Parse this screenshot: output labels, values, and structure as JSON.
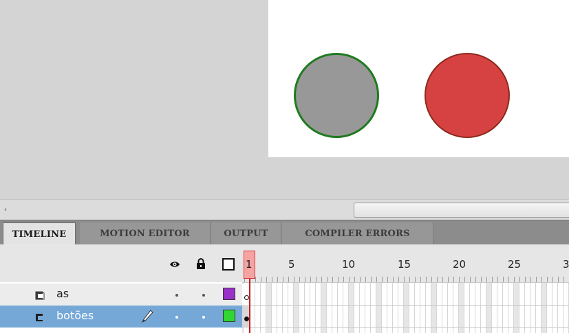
{
  "stage": {
    "pasteboard_color": "#d4d4d4",
    "stage_color": "#ffffff",
    "circles": [
      {
        "name": "gray-circle",
        "fill": "#989898",
        "stroke": "#1f7a1f"
      },
      {
        "name": "red-circle",
        "fill": "#d64141",
        "stroke": "#8b2a1d"
      }
    ]
  },
  "scrollbar": {
    "left_arrow": "‹"
  },
  "tabs": [
    {
      "label": "TIMELINE",
      "active": true
    },
    {
      "label": "MOTION EDITOR",
      "active": false
    },
    {
      "label": "OUTPUT",
      "active": false
    },
    {
      "label": "COMPILER ERRORS",
      "active": false
    }
  ],
  "timeline": {
    "header_icons": [
      "eye-icon",
      "lock-icon",
      "outline-icon"
    ],
    "current_frame": "1",
    "frame_numbers": [
      "1",
      "5",
      "10",
      "15",
      "20",
      "25",
      "3"
    ],
    "layers": [
      {
        "name": "as",
        "color": "#9b30c8",
        "selected": false,
        "icon": "layer-icon"
      },
      {
        "name": "botões",
        "color": "#31d631",
        "selected": true,
        "icon": "layer-icon",
        "editing_icon": "pencil-icon"
      }
    ]
  }
}
